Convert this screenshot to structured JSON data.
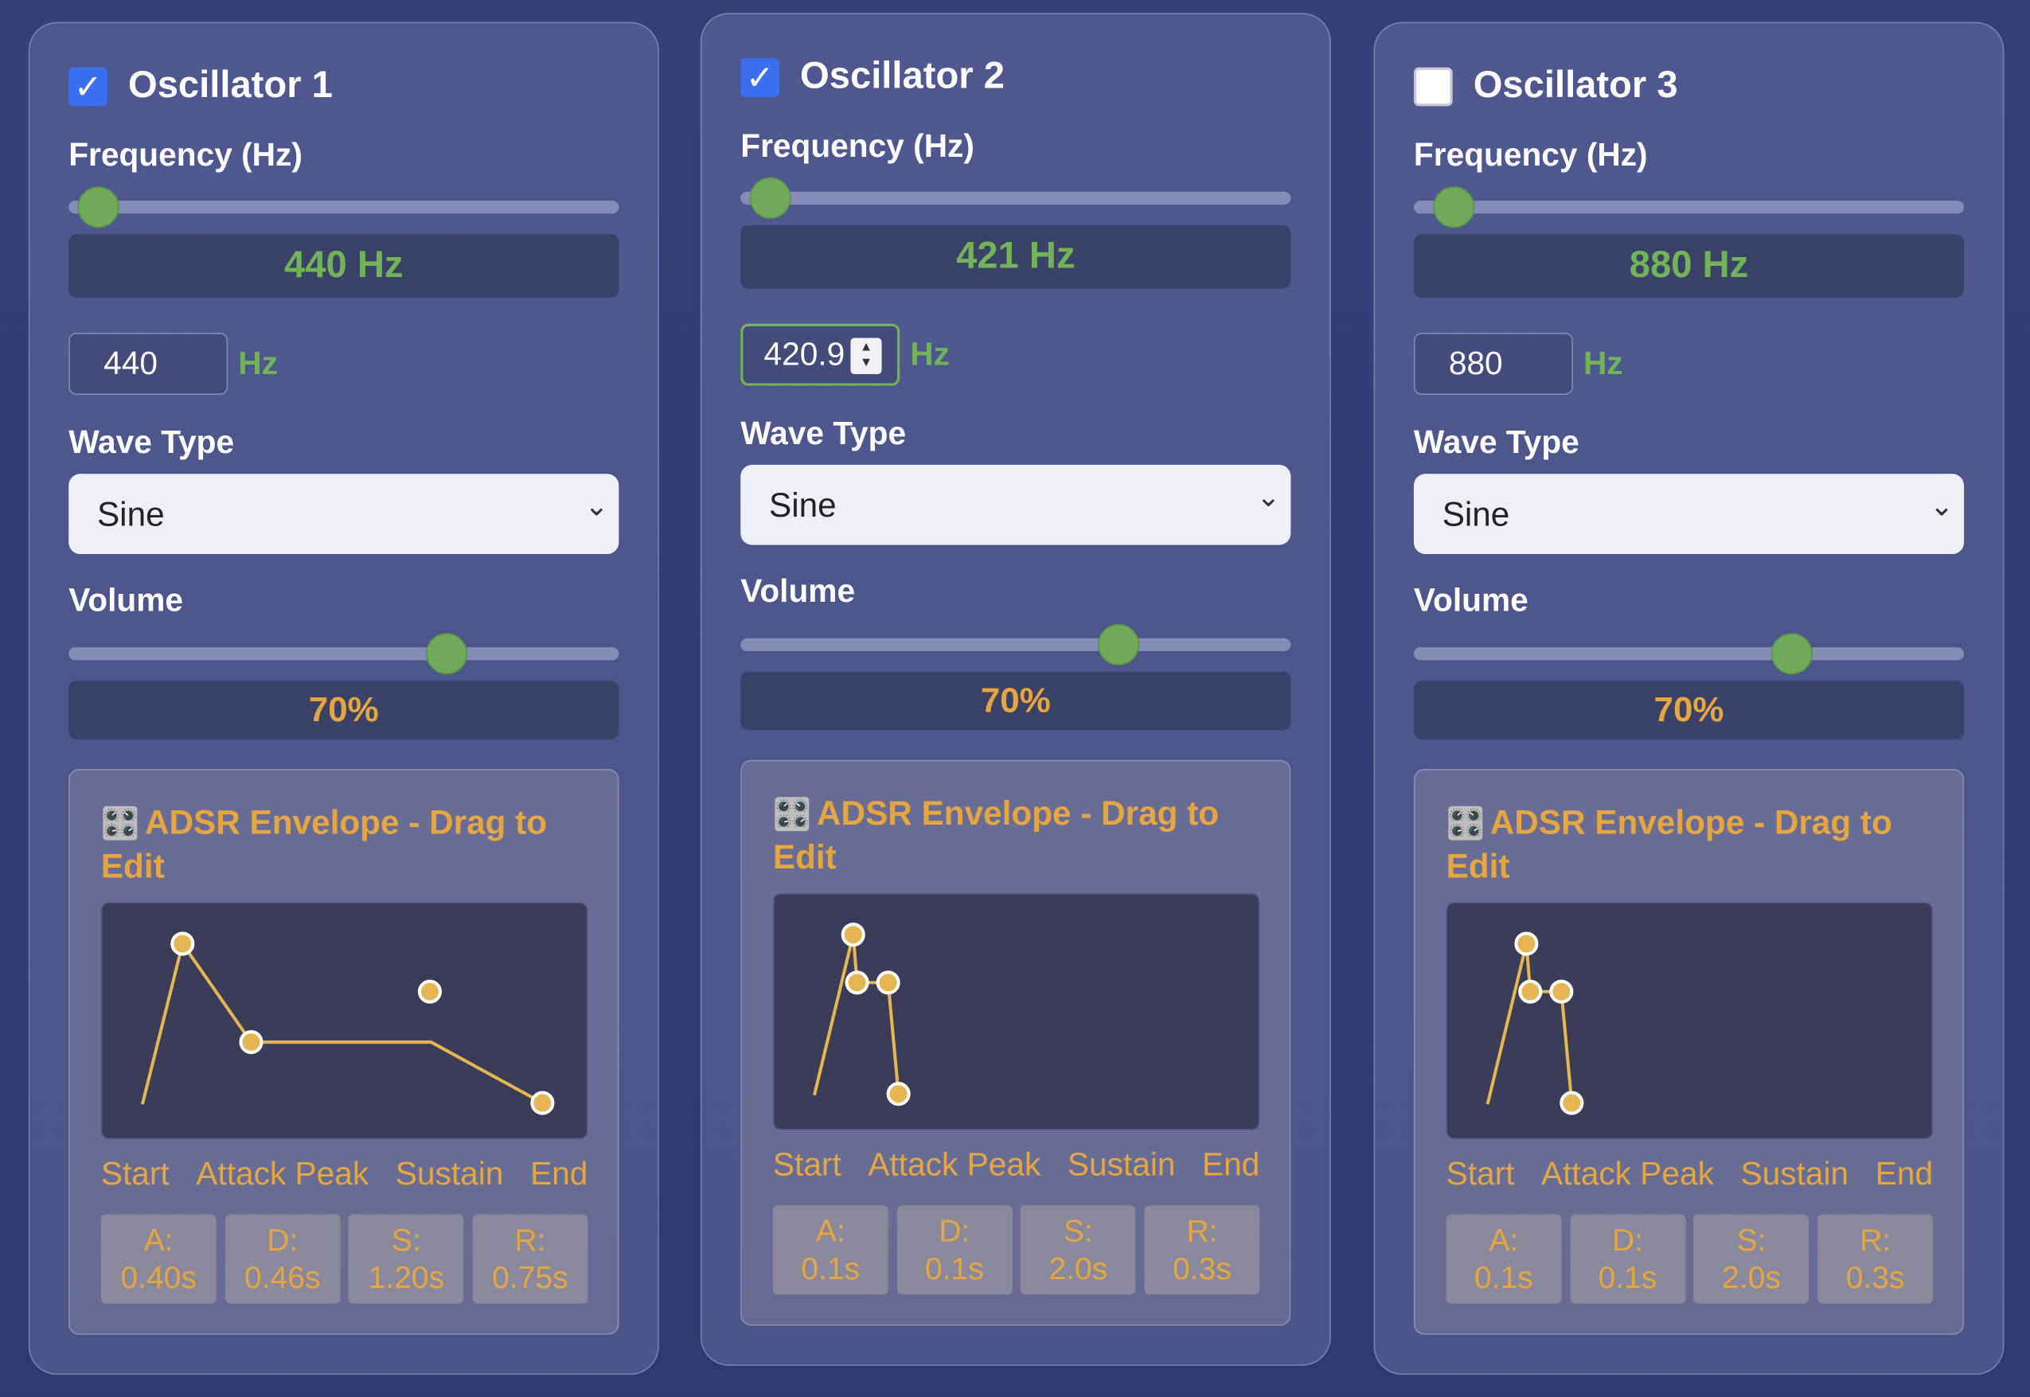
{
  "colors": {
    "accent_green": "#72b35a",
    "accent_orange": "#e5a540",
    "checkbox_blue": "#3a6ff0"
  },
  "oscillators": [
    {
      "title": "Oscillator 1",
      "enabled": true,
      "frequency_label": "Frequency (Hz)",
      "frequency_display": "440 Hz",
      "frequency_input": "440",
      "frequency_unit": "Hz",
      "frequency_slider_fraction": 0.054,
      "wave_label": "Wave Type",
      "wave_value": "Sine",
      "volume_label": "Volume",
      "volume_display": "70%",
      "volume_fraction": 0.686,
      "envelope_title": "ADSR Envelope - Drag to Edit",
      "envelope_icon": "control-knobs-icon",
      "phases": [
        "Start",
        "Attack Peak",
        "Sustain",
        "End"
      ],
      "params": [
        {
          "k": "A:",
          "v": "0.40s"
        },
        {
          "k": "D:",
          "v": "0.46s"
        },
        {
          "k": "S:",
          "v": "1.20s"
        },
        {
          "k": "R:",
          "v": "0.75s"
        }
      ]
    },
    {
      "title": "Oscillator 2",
      "enabled": true,
      "frequency_label": "Frequency (Hz)",
      "frequency_display": "421 Hz",
      "frequency_input": "420.9",
      "frequency_unit": "Hz",
      "frequency_slider_fraction": 0.054,
      "wave_label": "Wave Type",
      "wave_value": "Sine",
      "volume_label": "Volume",
      "volume_display": "70%",
      "volume_fraction": 0.686,
      "envelope_title": "ADSR Envelope - Drag to Edit",
      "envelope_icon": "control-knobs-icon",
      "phases": [
        "Start",
        "Attack Peak",
        "Sustain",
        "End"
      ],
      "params": [
        {
          "k": "A:",
          "v": "0.1s"
        },
        {
          "k": "D:",
          "v": "0.1s"
        },
        {
          "k": "S:",
          "v": "2.0s"
        },
        {
          "k": "R:",
          "v": "0.3s"
        }
      ]
    },
    {
      "title": "Oscillator 3",
      "enabled": false,
      "frequency_label": "Frequency (Hz)",
      "frequency_display": "880 Hz",
      "frequency_input": "880",
      "frequency_unit": "Hz",
      "frequency_slider_fraction": 0.072,
      "wave_label": "Wave Type",
      "wave_value": "Sine",
      "volume_label": "Volume",
      "volume_display": "70%",
      "volume_fraction": 0.686,
      "envelope_title": "ADSR Envelope - Drag to Edit",
      "envelope_icon": "control-knobs-icon",
      "phases": [
        "Start",
        "Attack Peak",
        "Sustain",
        "End"
      ],
      "params": [
        {
          "k": "A:",
          "v": "0.1s"
        },
        {
          "k": "D:",
          "v": "0.1s"
        },
        {
          "k": "S:",
          "v": "2.0s"
        },
        {
          "k": "R:",
          "v": "0.3s"
        }
      ]
    }
  ]
}
